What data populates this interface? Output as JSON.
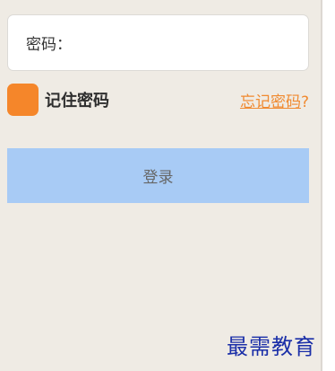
{
  "password": {
    "label": "密码：",
    "value": ""
  },
  "remember": {
    "label": "记住密码",
    "checked_color": "#f5862a"
  },
  "forgot": {
    "link_text": "忘记密码",
    "suffix": "?"
  },
  "login": {
    "label": "登录"
  },
  "watermark": {
    "text": "最需教育"
  },
  "colors": {
    "background": "#efebe4",
    "accent": "#f5862a",
    "button": "#a8cbf5"
  }
}
